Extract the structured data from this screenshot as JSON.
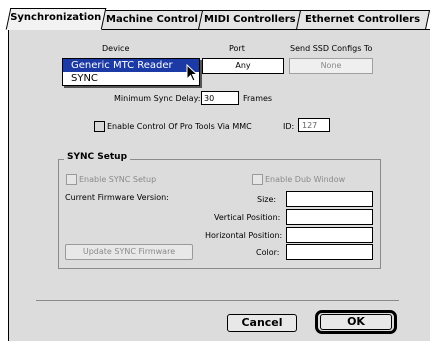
{
  "tabs": [
    "Synchronization",
    "Machine Control",
    "MIDI Controllers",
    "Ethernet Controllers"
  ],
  "headers": {
    "device": "Device",
    "port": "Port",
    "send_ssd": "Send SSD Configs To"
  },
  "device_menu": {
    "options": [
      "Generic MTC Reader",
      "SYNC"
    ],
    "selected": "Generic MTC Reader"
  },
  "port_value": "Any",
  "send_ssd_value": "None",
  "min_sync_delay": {
    "label": "Minimum Sync Delay:",
    "value": "30",
    "units": "Frames"
  },
  "mmc": {
    "label": "Enable Control Of Pro Tools Via MMC",
    "id_label": "ID:",
    "id_value": "127"
  },
  "sync_setup": {
    "title": "SYNC Setup",
    "enable_label": "Enable SYNC Setup",
    "dub_label": "Enable Dub Window",
    "firmware_label": "Current Firmware Version:",
    "size_label": "Size:",
    "vpos_label": "Vertical Position:",
    "hpos_label": "Horizontal Position:",
    "color_label": "Color:",
    "update_button": "Update SYNC Firmware"
  },
  "buttons": {
    "cancel": "Cancel",
    "ok": "OK"
  }
}
